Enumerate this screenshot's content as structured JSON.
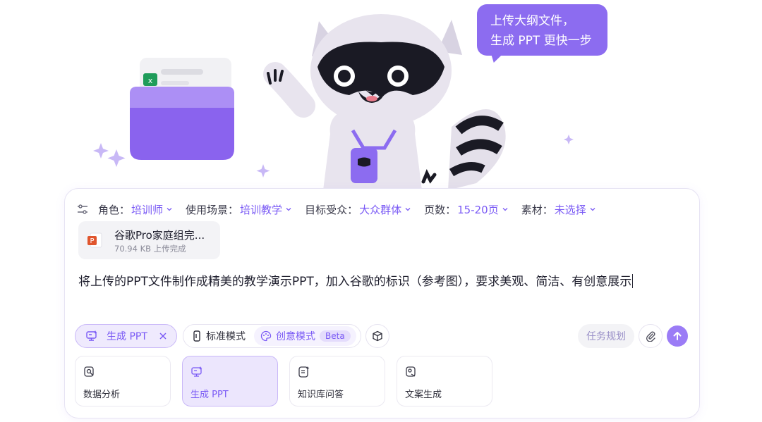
{
  "hero": {
    "bubble_lines": [
      "上传大纲文件，",
      "生成 PPT 更快一步"
    ],
    "mascot_icon": "raccoon-mascot-icon",
    "folder_icon": "purple-folder-icon"
  },
  "options": [
    {
      "label": "角色：",
      "value": "培训师"
    },
    {
      "label": "使用场景：",
      "value": "培训教学"
    },
    {
      "label": "目标受众：",
      "value": "大众群体"
    },
    {
      "label": "页数：",
      "value": "15-20页"
    },
    {
      "label": "素材：",
      "value": "未选择"
    }
  ],
  "file": {
    "name": "谷歌Pro家庭组完...",
    "status": "70.94 KB 上传完成",
    "icon": "ppt-file-icon"
  },
  "prompt": "将上传的PPT文件制作成精美的教学演示PPT，加入谷歌的标识（参考图），要求美观、简洁、有创意展示",
  "toolbar": {
    "active_tool": "生成 PPT",
    "mode_standard": "标准模式",
    "mode_creative": "创意模式",
    "beta": "Beta",
    "plan": "任务规划"
  },
  "cards": [
    {
      "label": "数据分析",
      "icon": "data-analysis-icon",
      "active": false
    },
    {
      "label": "生成 PPT",
      "icon": "ppt-generate-icon",
      "active": true
    },
    {
      "label": "知识库问答",
      "icon": "knowledge-qa-icon",
      "active": false
    },
    {
      "label": "文案生成",
      "icon": "copywriting-icon",
      "active": false
    }
  ],
  "colors": {
    "accent": "#7a5af5",
    "bubble": "#8c6cf0",
    "send": "#9b7cf6"
  }
}
